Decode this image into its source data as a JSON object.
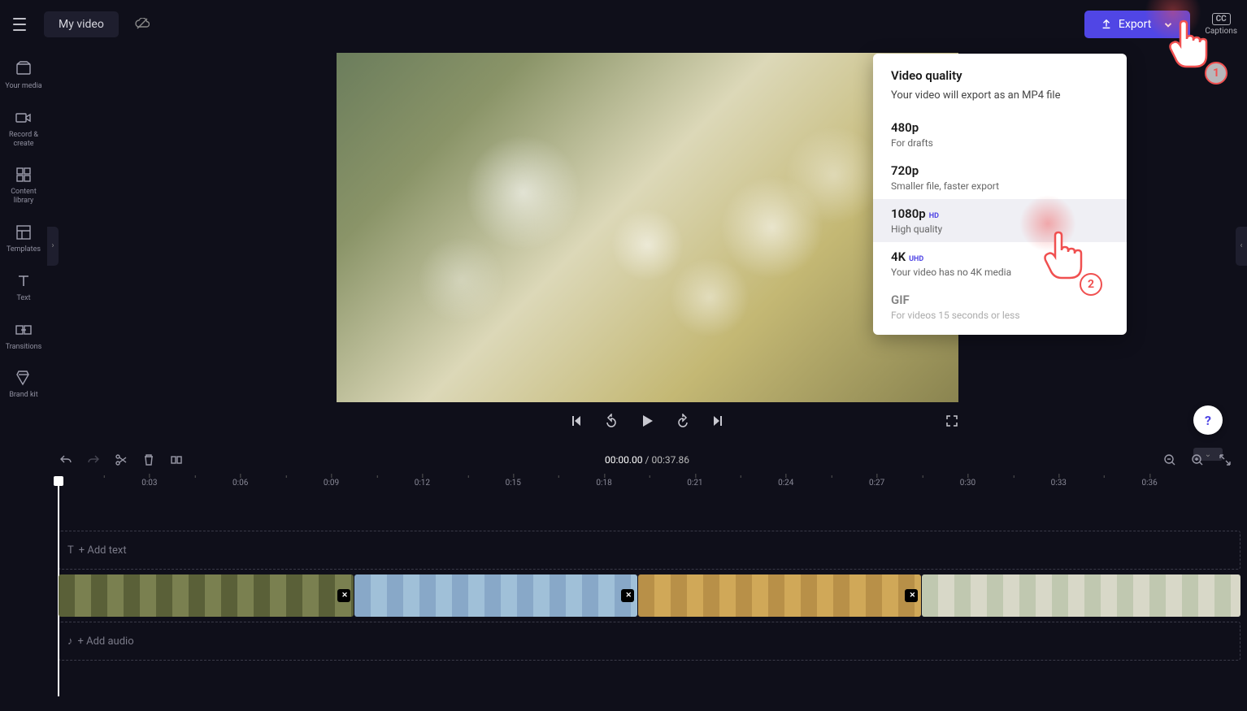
{
  "project_title": "My video",
  "export_button": "Export",
  "captions_label": "Captions",
  "sidebar": [
    {
      "label": "Your media",
      "icon": "media"
    },
    {
      "label": "Record & create",
      "icon": "record"
    },
    {
      "label": "Content library",
      "icon": "library"
    },
    {
      "label": "Templates",
      "icon": "templates"
    },
    {
      "label": "Text",
      "icon": "text"
    },
    {
      "label": "Transitions",
      "icon": "transitions"
    },
    {
      "label": "Brand kit",
      "icon": "brand"
    }
  ],
  "export_menu": {
    "title": "Video quality",
    "subtitle": "Your video will export as an MP4 file",
    "options": [
      {
        "label": "480p",
        "badge": "",
        "desc": "For drafts",
        "state": "normal"
      },
      {
        "label": "720p",
        "badge": "",
        "desc": "Smaller file, faster export",
        "state": "normal"
      },
      {
        "label": "1080p",
        "badge": "HD",
        "desc": "High quality",
        "state": "highlighted"
      },
      {
        "label": "4K",
        "badge": "UHD",
        "desc": "Your video has no 4K media",
        "state": "normal"
      },
      {
        "label": "GIF",
        "badge": "",
        "desc": "For videos 15 seconds or less",
        "state": "disabled"
      }
    ]
  },
  "time": {
    "current": "00:00.00",
    "total": "00:37.86"
  },
  "ruler_ticks": [
    "0:03",
    "0:06",
    "0:09",
    "0:12",
    "0:15",
    "0:18",
    "0:21",
    "0:24",
    "0:27",
    "0:30",
    "0:33",
    "0:36"
  ],
  "tracks": {
    "add_text": "+ Add text",
    "add_audio": "+ Add audio"
  },
  "annotations": {
    "step1": "1",
    "step2": "2"
  },
  "help": "?"
}
